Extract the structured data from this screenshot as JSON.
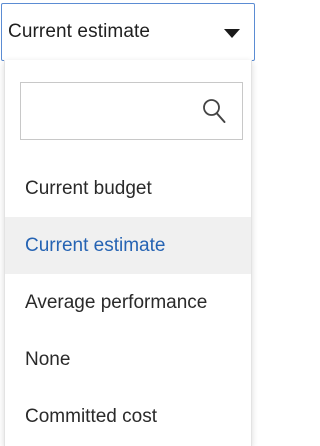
{
  "select": {
    "value": "Current estimate"
  },
  "dropdown": {
    "search": {
      "value": "",
      "placeholder": ""
    },
    "options": [
      {
        "label": "Current budget",
        "selected": false
      },
      {
        "label": "Current estimate",
        "selected": true
      },
      {
        "label": "Average performance",
        "selected": false
      },
      {
        "label": "None",
        "selected": false
      },
      {
        "label": "Committed cost",
        "selected": false
      }
    ]
  },
  "icons": {
    "caret": "caret-down-icon",
    "search": "search-icon"
  },
  "colors": {
    "selected_text": "#2563b3",
    "selected_bg": "#f0f0f0",
    "trigger_border": "#5b8cd3"
  }
}
